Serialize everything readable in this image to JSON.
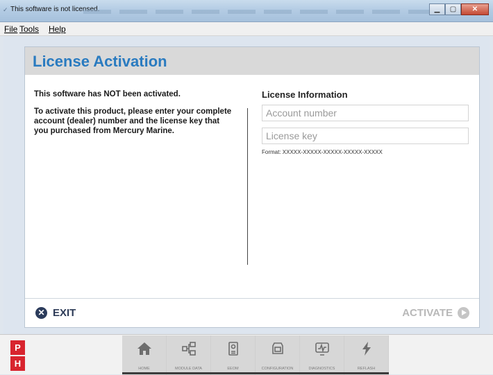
{
  "window": {
    "title": "This software is not licensed."
  },
  "menu": {
    "items": [
      {
        "label": "File"
      },
      {
        "label": "Tools"
      },
      {
        "label": "Help"
      }
    ]
  },
  "panel": {
    "title": "License Activation",
    "left": {
      "status": "This software has NOT been activated.",
      "instructions": "To activate this product, please enter your complete account (dealer) number and the license key that you purchased from Mercury Marine."
    },
    "right": {
      "heading": "License Information",
      "account_placeholder": "Account number",
      "account_value": "",
      "license_placeholder": "License key",
      "license_value": "",
      "format": "Format: XXXXX-XXXXX-XXXXX-XXXXX-XXXXX"
    },
    "footer": {
      "exit_label": "EXIT",
      "activate_label": "ACTIVATE"
    }
  },
  "bottombar": {
    "logo_top": "P",
    "logo_bottom": "H",
    "nav": [
      {
        "label": "HOME",
        "icon": "home-icon"
      },
      {
        "label": "MODULE DATA",
        "icon": "module-data-icon"
      },
      {
        "label": "EEOM",
        "icon": "eeom-icon"
      },
      {
        "label": "CONFIGURATION",
        "icon": "configuration-icon"
      },
      {
        "label": "DIAGNOSTICS",
        "icon": "diagnostics-icon"
      },
      {
        "label": "REFLASH",
        "icon": "reflash-icon"
      }
    ]
  },
  "colors": {
    "accent": "#2a7bc0",
    "exit": "#2b3b5b",
    "disabled": "#b8b8b8",
    "brand_red": "#d8242e"
  }
}
